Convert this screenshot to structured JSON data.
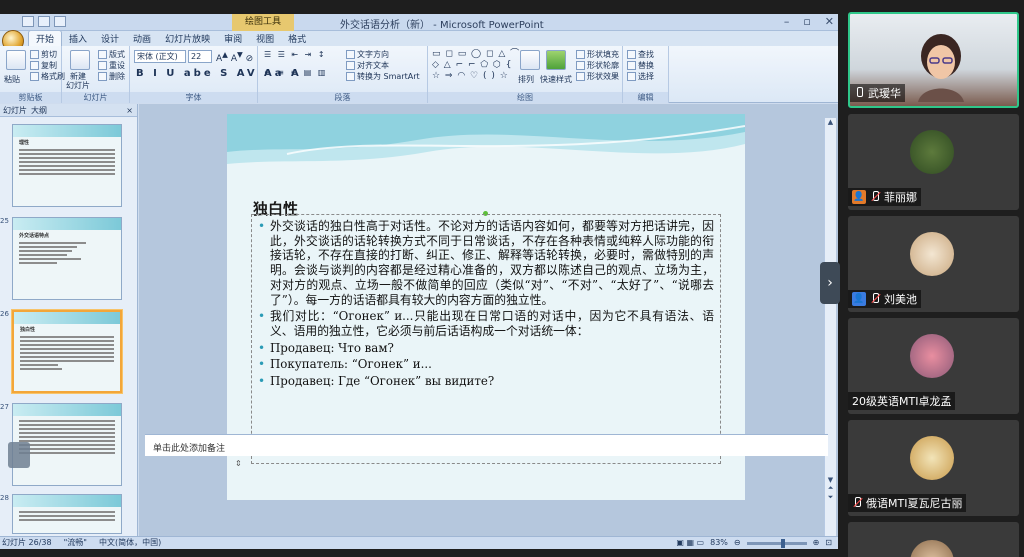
{
  "ppt": {
    "context_tab": "绘图工具",
    "window_title": "外交话语分析（新） - Microsoft PowerPoint",
    "tabs": [
      "开始",
      "插入",
      "设计",
      "动画",
      "幻灯片放映",
      "审阅",
      "视图",
      "格式"
    ],
    "ribbon": {
      "clipboard": {
        "paste": "粘贴",
        "cut": "剪切",
        "copy": "复制",
        "format_painter": "格式刷",
        "label": "剪贴板"
      },
      "slides": {
        "new_slide": "新建\n幻灯片",
        "layout": "版式",
        "reset": "重设",
        "delete": "删除",
        "label": "幻灯片"
      },
      "font": {
        "name": "宋体 (正文)",
        "size": "22",
        "label": "字体"
      },
      "paragraph": {
        "text_direction": "文字方向",
        "align_text": "对齐文本",
        "smartart": "转换为 SmartArt",
        "label": "段落"
      },
      "drawing": {
        "arrange": "排列",
        "quick_styles": "快速样式",
        "shape_fill": "形状填充",
        "shape_outline": "形状轮廓",
        "shape_effects": "形状效果",
        "label": "绘图"
      },
      "editing": {
        "find": "查找",
        "replace": "替换",
        "select": "选择",
        "label": "编辑"
      }
    },
    "left_tabs": {
      "slides": "幻灯片",
      "outline": "大纲",
      "close": "×"
    },
    "thumbnails": [
      {
        "num": "",
        "title": "理性"
      },
      {
        "num": "25",
        "title": "外交话语特点"
      },
      {
        "num": "26",
        "title": "独白性"
      },
      {
        "num": "27",
        "title": ""
      },
      {
        "num": "28",
        "title": ""
      }
    ],
    "slide": {
      "title": "独白性",
      "bullets": [
        "外交谈话的独白性高于对话性。不论对方的话语内容如何，都要等对方把话讲完，因此，外交谈话的话轮转换方式不同于日常谈话，不存在各种表情或纯粹人际功能的衔接话轮，不存在直接的打断、纠正、修正、解释等话轮转换，必要时，需做特别的声明。会谈与谈判的内容都是经过精心准备的，双方都以陈述自己的观点、立场为主，对对方的观点、立场一般不做简单的回应（类似“对”、“不对”、“太好了”、“说哪去了”）。每一方的话语都具有较大的内容方面的独立性。",
        "我们对比：“Огонек” и...只能出现在日常口语的对话中，因为它不具有语法、语义、语用的独立性，它必须与前后话语构成一个对话统一体：",
        "Продавец: Что вам?",
        "Покупатель: “Огонек” и...",
        "Продавец: Где “Огонек” вы видите?"
      ]
    },
    "notes_placeholder": "单击此处添加备注",
    "status": {
      "slide_info": "幻灯片 26/38",
      "theme": "\"流畅\"",
      "language": "中文(简体，中国)",
      "zoom": "83%"
    }
  },
  "participants": [
    {
      "name": "武瑷华",
      "mic": "on",
      "badge": "",
      "video": true
    },
    {
      "name": "菲丽娜",
      "mic": "off",
      "badge": "orange"
    },
    {
      "name": "刘美池",
      "mic": "off",
      "badge": "blue"
    },
    {
      "name": "20级英语MTI卓龙孟",
      "mic": "none",
      "badge": ""
    },
    {
      "name": "俄语MTI夏瓦尼古丽",
      "mic": "off",
      "badge": ""
    }
  ],
  "colors": {
    "active_speaker": "#2fc78a",
    "ppt_chrome": "#cfdcee",
    "bullet": "#2a9bb6"
  }
}
